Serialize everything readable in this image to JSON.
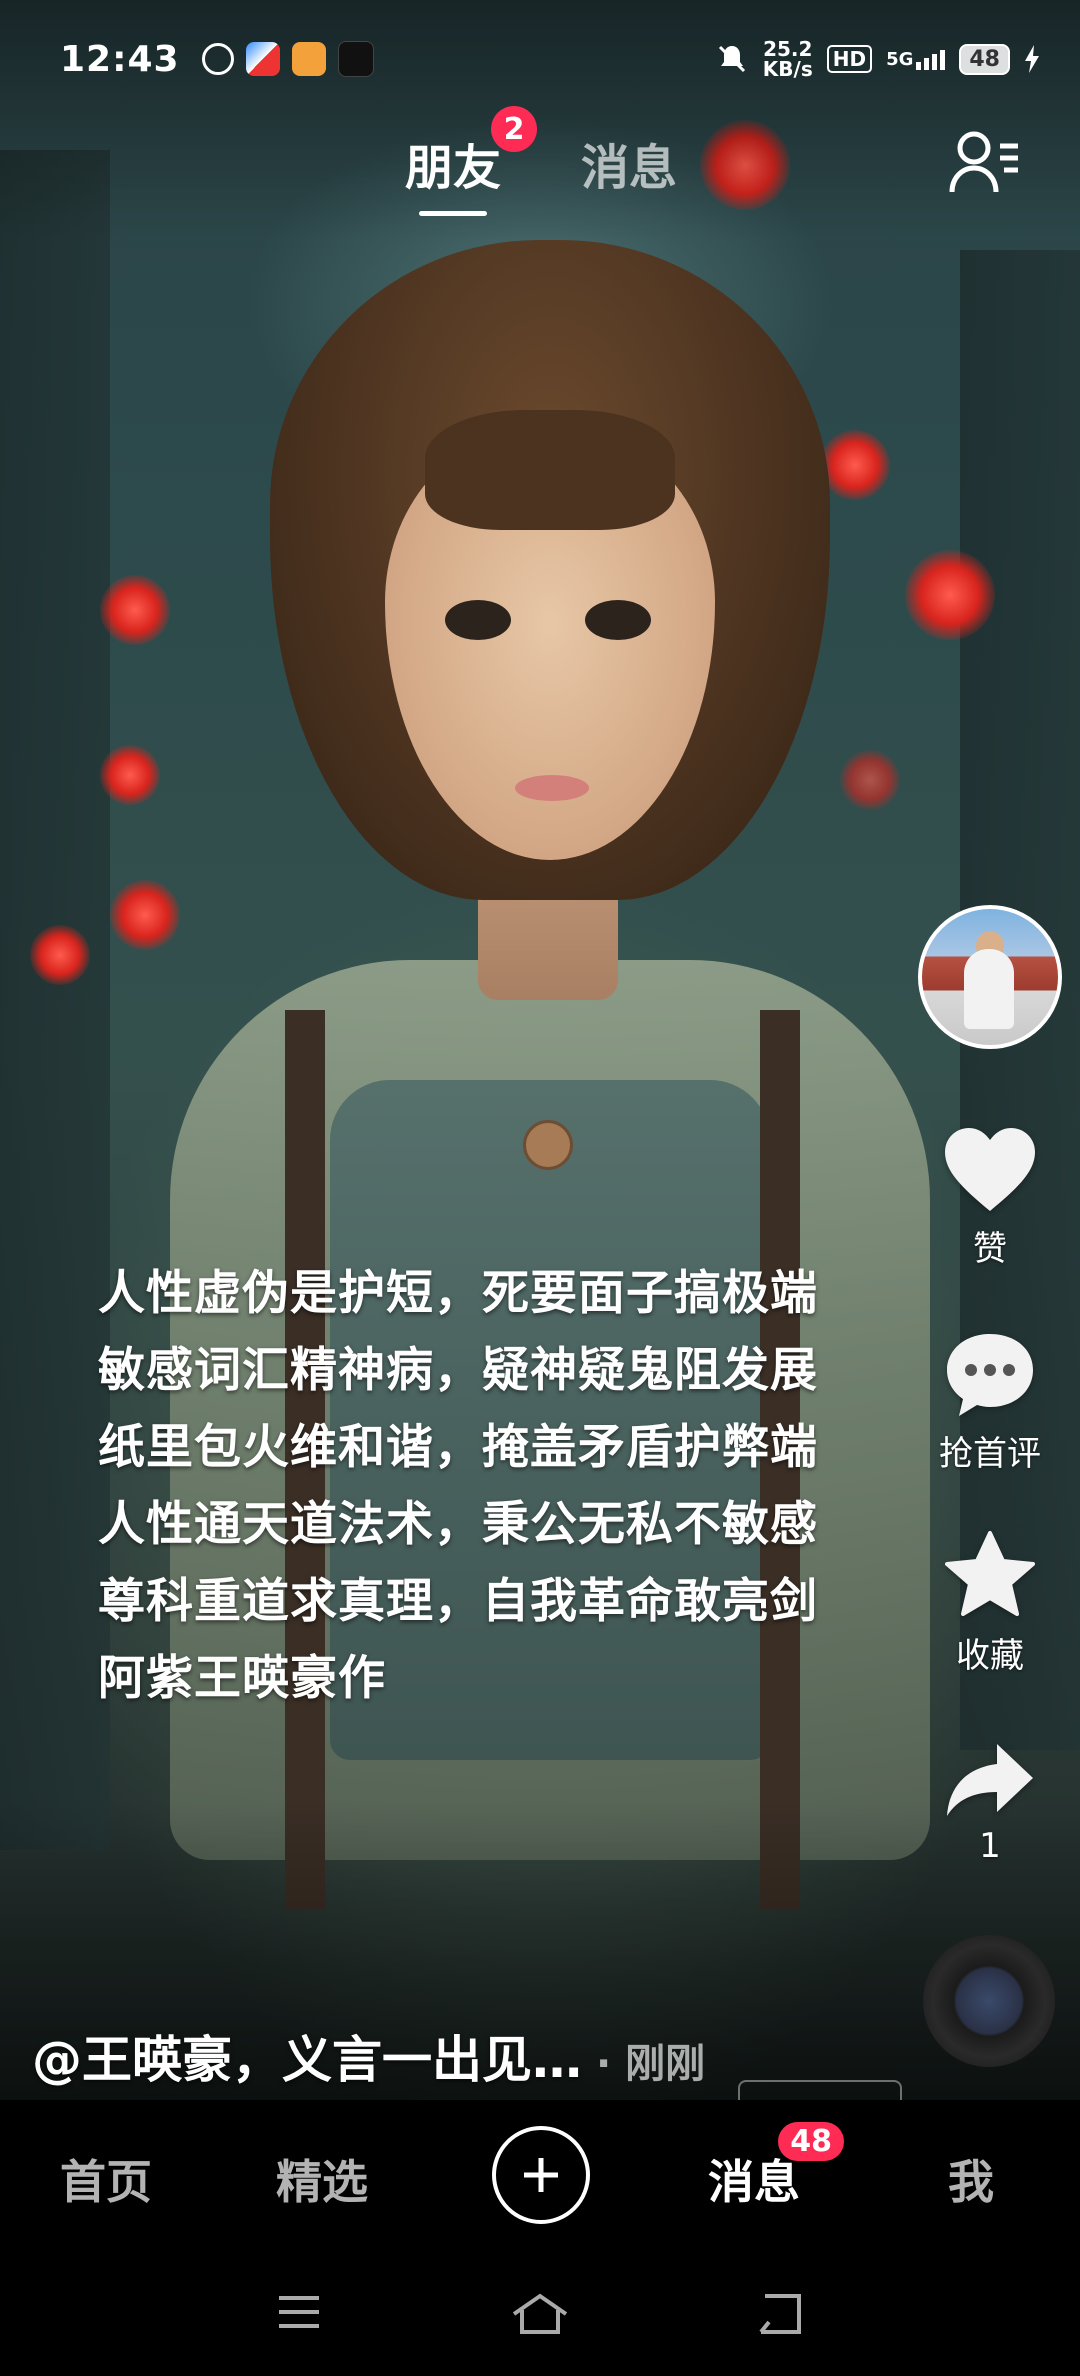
{
  "status_bar": {
    "time": "12:43",
    "net_speed_value": "25.2",
    "net_speed_unit": "KB/s",
    "hd": "HD",
    "signal": "5G",
    "battery": "48"
  },
  "top_tabs": [
    {
      "label": "朋友",
      "badge": "2",
      "active": true
    },
    {
      "label": "消息",
      "active": false
    }
  ],
  "right_rail": {
    "like_label": "赞",
    "comment_label": "抢首评",
    "favorite_label": "收藏",
    "share_count": "1"
  },
  "poem": {
    "lines": [
      "人性虚伪是护短，死要面子搞极端",
      "敏感词汇精神病，疑神疑鬼阻发展",
      "纸里包火维和谐，掩盖矛盾护弊端",
      "人性通天道法术，秉公无私不敏感",
      "尊科重道求真理，自我革命敢亮剑",
      "阿紫王暎豪作"
    ]
  },
  "caption": {
    "text": "@王暎豪，义言一出见…",
    "time": "· 刚刚"
  },
  "bottom_nav": {
    "home": "首页",
    "featured": "精选",
    "messages": "消息",
    "messages_badge": "48",
    "me": "我"
  },
  "colors": {
    "badge": "#fe2c55",
    "nav_bg": "#000000"
  }
}
